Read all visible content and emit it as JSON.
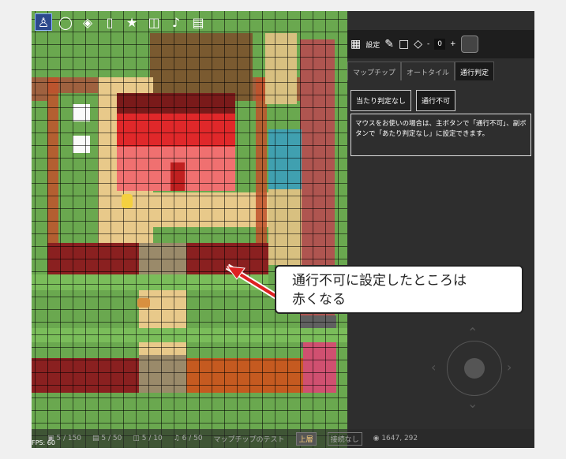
{
  "toolbar": {
    "tools": [
      "person-icon",
      "speech-bubble-icon",
      "layers-icon",
      "page-icon",
      "bicycle-icon",
      "image-icon",
      "music-note-icon",
      "save-icon"
    ]
  },
  "panel": {
    "settings_label": "設定",
    "layer_number": "0",
    "minus": "-",
    "plus": "+",
    "tabs": [
      "マップチップ",
      "オートタイル",
      "通行判定"
    ],
    "buttons": [
      "当たり判定なし",
      "通行不可"
    ],
    "note": "マウスをお使いの場合は、主ボタンで「通行不可」、副ボタンで「あたり判定なし」に設定できます。"
  },
  "status": {
    "events": "5 / 150",
    "tiles": "5 / 50",
    "images": "5 / 10",
    "sounds": "6 / 50",
    "map_name": "マップチップのテスト",
    "chip1": "上層",
    "chip2": "接続なし",
    "coords": "1647, 292",
    "fps": "FPS: 60"
  },
  "callout": {
    "line1": "通行不可に設定したところは",
    "line2": "赤くなる"
  },
  "colors": {
    "blocked_overlay": "#cc2020",
    "grass": "#6aa84f",
    "path": "#e8c98a"
  }
}
